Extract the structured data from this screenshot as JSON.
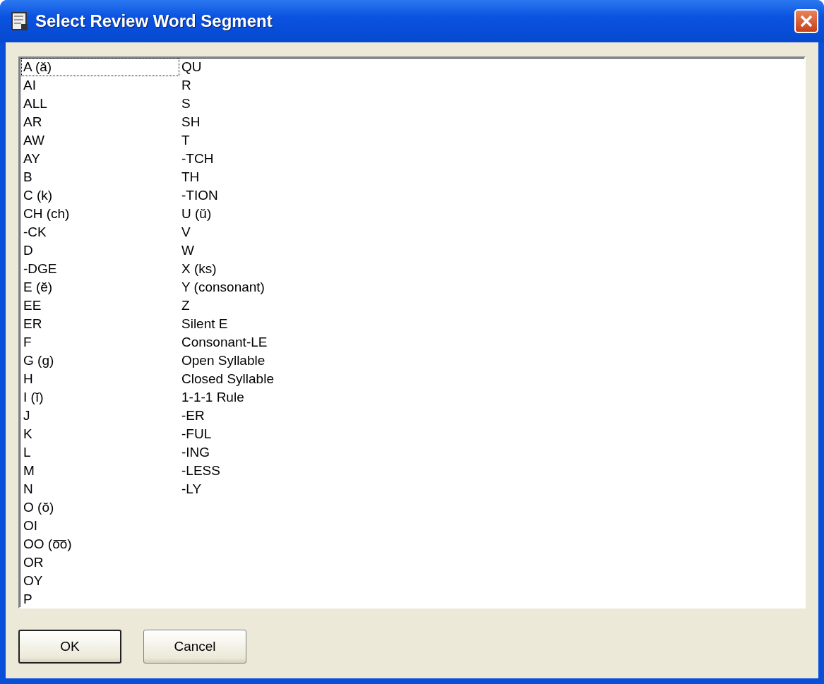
{
  "window": {
    "title": "Select Review Word Segment"
  },
  "list": {
    "items": [
      {
        "label": "A (ă)",
        "focused": true
      },
      {
        "label": "AI",
        "focused": false
      },
      {
        "label": "ALL",
        "focused": false
      },
      {
        "label": "AR",
        "focused": false
      },
      {
        "label": "AW",
        "focused": false
      },
      {
        "label": "AY",
        "focused": false
      },
      {
        "label": "B",
        "focused": false
      },
      {
        "label": "C (k)",
        "focused": false
      },
      {
        "label": "CH (ch)",
        "focused": false
      },
      {
        "label": "-CK",
        "focused": false
      },
      {
        "label": "D",
        "focused": false
      },
      {
        "label": "-DGE",
        "focused": false
      },
      {
        "label": "E (ĕ)",
        "focused": false
      },
      {
        "label": "EE",
        "focused": false
      },
      {
        "label": "ER",
        "focused": false
      },
      {
        "label": "F",
        "focused": false
      },
      {
        "label": "G (g)",
        "focused": false
      },
      {
        "label": "H",
        "focused": false
      },
      {
        "label": "I (ĭ)",
        "focused": false
      },
      {
        "label": "J",
        "focused": false
      },
      {
        "label": "K",
        "focused": false
      },
      {
        "label": "L",
        "focused": false
      },
      {
        "label": "M",
        "focused": false
      },
      {
        "label": "N",
        "focused": false
      },
      {
        "label": "O (ŏ)",
        "focused": false
      },
      {
        "label": "OI",
        "focused": false
      },
      {
        "label": "OO (o͞o)",
        "focused": false
      },
      {
        "label": "OR",
        "focused": false
      },
      {
        "label": "OY",
        "focused": false
      },
      {
        "label": "P",
        "focused": false
      },
      {
        "label": "QU",
        "focused": false
      },
      {
        "label": "R",
        "focused": false
      },
      {
        "label": "S",
        "focused": false
      },
      {
        "label": "SH",
        "focused": false
      },
      {
        "label": "T",
        "focused": false
      },
      {
        "label": "-TCH",
        "focused": false
      },
      {
        "label": "TH",
        "focused": false
      },
      {
        "label": "-TION",
        "focused": false
      },
      {
        "label": "U (ŭ)",
        "focused": false
      },
      {
        "label": "V",
        "focused": false
      },
      {
        "label": "W",
        "focused": false
      },
      {
        "label": "X (ks)",
        "focused": false
      },
      {
        "label": "Y (consonant)",
        "focused": false
      },
      {
        "label": "Z",
        "focused": false
      },
      {
        "label": "Silent E",
        "focused": false
      },
      {
        "label": "Consonant-LE",
        "focused": false
      },
      {
        "label": "Open Syllable",
        "focused": false
      },
      {
        "label": "Closed Syllable",
        "focused": false
      },
      {
        "label": "1-1-1 Rule",
        "focused": false
      },
      {
        "label": "-ER",
        "focused": false
      },
      {
        "label": "-FUL",
        "focused": false
      },
      {
        "label": "-ING",
        "focused": false
      },
      {
        "label": "-LESS",
        "focused": false
      },
      {
        "label": "-LY",
        "focused": false
      }
    ]
  },
  "buttons": [
    {
      "label": "OK",
      "default": true
    },
    {
      "label": "Cancel",
      "default": false
    }
  ]
}
